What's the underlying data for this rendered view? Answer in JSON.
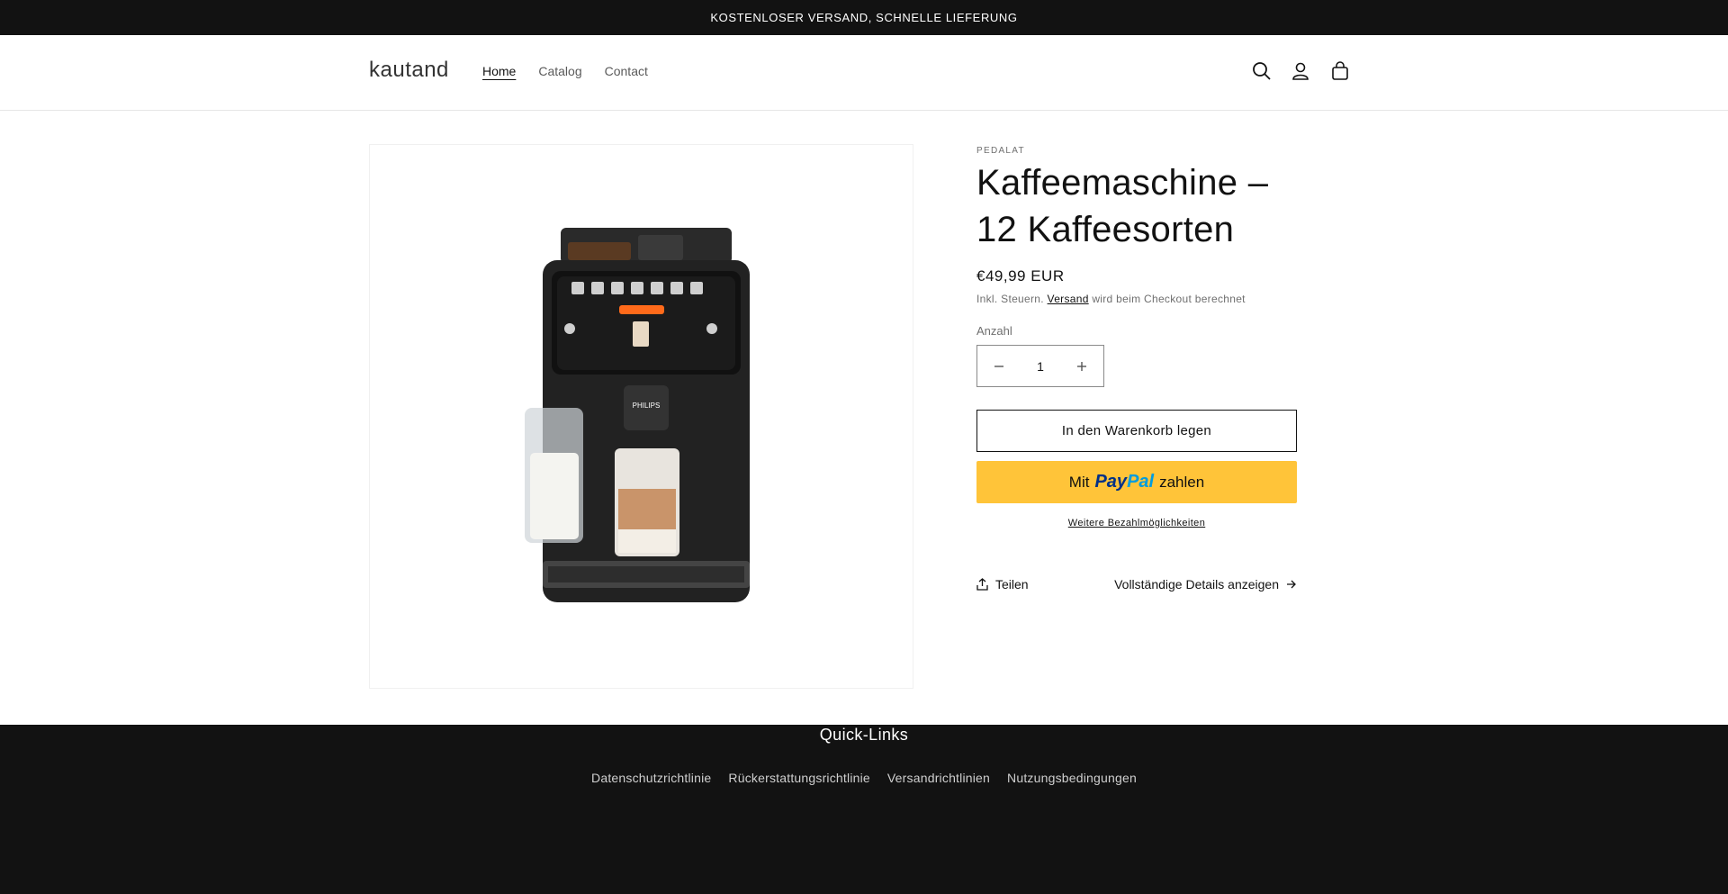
{
  "announcement": {
    "text": "KOSTENLOSER VERSAND, SCHNELLE LIEFERUNG"
  },
  "header": {
    "logo": "kautand",
    "nav": [
      {
        "label": "Home",
        "active": true
      },
      {
        "label": "Catalog",
        "active": false
      },
      {
        "label": "Contact",
        "active": false
      }
    ],
    "icons": [
      "search-icon",
      "account-icon",
      "cart-icon"
    ]
  },
  "product": {
    "image_alt": "PHILIPS",
    "vendor": "PEDALAT",
    "title": "Kaffeemaschine – 12 Kaffeesorten",
    "price": "€49,99 EUR",
    "tax_prefix": "Inkl. Steuern.",
    "tax_link": "Versand",
    "tax_suffix": "wird beim Checkout berechnet",
    "quantity_label": "Anzahl",
    "quantity_value": "1",
    "add_to_cart": "In den Warenkorb legen",
    "paypal_prefix": "Mit",
    "paypal_brand_1": "Pay",
    "paypal_brand_2": "Pal",
    "paypal_suffix": "zahlen",
    "more_payment": "Weitere Bezahlmöglichkeiten",
    "share": "Teilen",
    "full_details": "Vollständige Details anzeigen"
  },
  "footer": {
    "heading": "Quick-Links",
    "links": [
      "Datenschutzrichtlinie",
      "Rückerstattungsrichtlinie",
      "Versandrichtlinien",
      "Nutzungsbedingungen"
    ]
  },
  "colors": {
    "dark": "#121212",
    "paypal": "#ffc439",
    "paypal_blue_dark": "#003087",
    "paypal_blue_light": "#009cde"
  }
}
